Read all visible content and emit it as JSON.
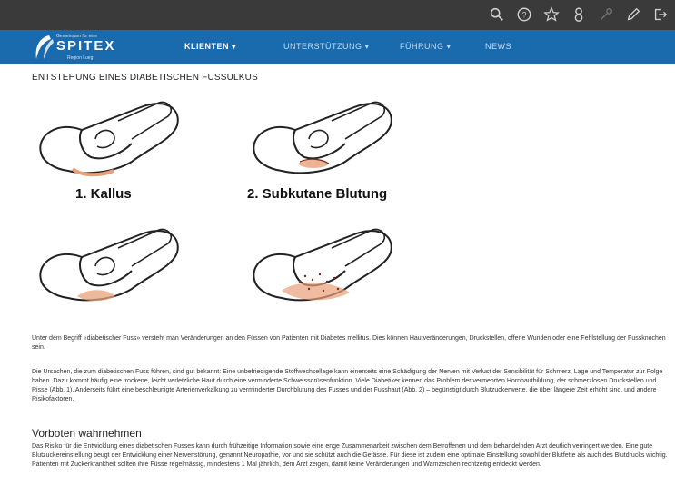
{
  "toolbar": {
    "icons": [
      "search-icon",
      "help-icon",
      "star-icon",
      "user-icon",
      "key-icon",
      "edit-icon",
      "logout-icon"
    ]
  },
  "logo": {
    "small_text": "Gemeinsam für eine",
    "word": "SPITEX",
    "sub_text": "Region Lueg"
  },
  "nav": {
    "items": [
      {
        "label": "KLIENTEN  ▾"
      },
      {
        "label": "UNTERSTÜTZUNG  ▾"
      },
      {
        "label": "FÜHRUNG  ▾"
      },
      {
        "label": "NEWS"
      }
    ]
  },
  "page": {
    "title": "ENTSTEHUNG EINES DIABETISCHEN FUSSULKUS",
    "figure_labels": [
      "1. Kallus",
      "2. Subkutane Blutung"
    ],
    "paragraph1": "Unter dem Begriff «diabetischer Fuss» versteht man Veränderungen an den Füssen von Patienten mit Diabetes mellitus. Dies können Hautveränderungen, Druckstellen, offene Wunden oder eine Fehlstellung der Fussknochen sein.",
    "paragraph2": "Die Ursachen, die zum diabetischen Fuss führen, sind gut bekannt: Eine unbefriedigende Stoffwechsellage kann einerseits eine Schädigung der Nerven mit Verlust der Sensibilität für Schmerz, Lage und Temperatur zur Folge haben. Dazu kommt häufig eine trockene, leicht verletzliche Haut durch eine verminderte Schweissdrüsenfunktion. Viele Diabetiker kennen das Problem der vermehrten Hornhautbildung, der schmerzlosen Druckstellen und Risse (Abb. 1). Anderseits führt eine beschleunigte Arterienverkalkung zu verminderter Durchblutung des Fusses und der Fusshaut (Abb. 2) – begünstigt durch Blutzuckerwerte, die über längere Zeit erhöht sind, und andere Risikofaktoren.",
    "heading2": "Vorboten wahrnehmen",
    "paragraph3": "Das Risiko für die Entwicklung eines diabetischen Fusses kann durch frühzeitige Information sowie eine enge Zusammenarbeit zwischen dem Betroffenen und dem behandelnden Arzt deutlich verringert werden. Eine gute Blutzuckereinstellung beugt der Entwicklung einer Nervenstörung, genannt Neuropathie, vor und sie schützt auch die Gefässe. Für diese ist zudem eine optimale Einstellung sowohl der Blutfette als auch des Blutdrucks wichtig. Patienten mit Zuckerkrankheit sollten ihre Füsse regelmässig, mindestens 1 Mal jährlich, dem Arzt zeigen, damit keine Veränderungen und Warnzeichen rechtzeitig entdeckt werden."
  },
  "colors": {
    "topbar": "#3a3a3a",
    "nav": "#1a6aae",
    "lesion": "#e8a07a"
  }
}
